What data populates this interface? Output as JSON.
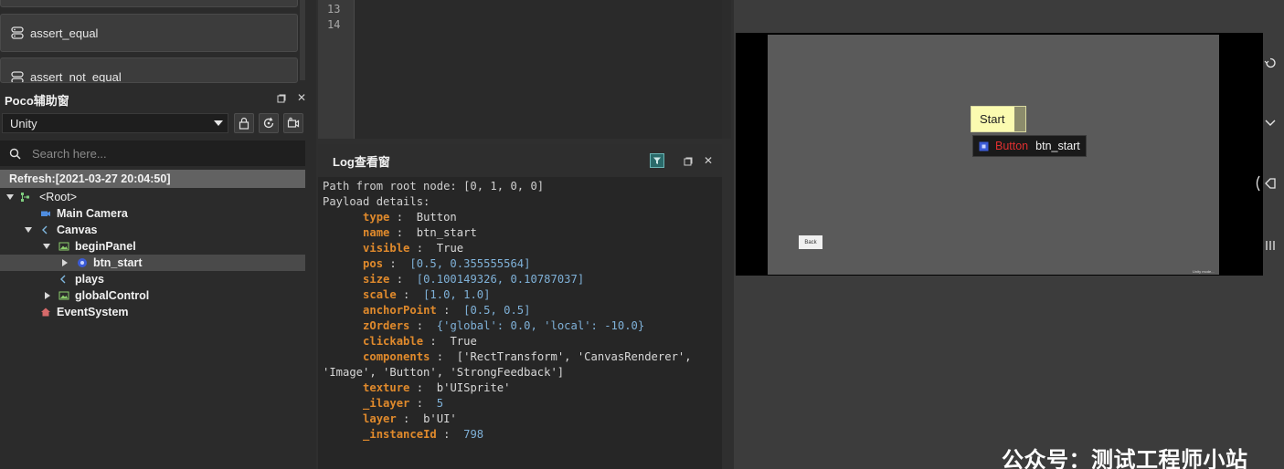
{
  "assert_panel": {
    "items": [
      {
        "label": ""
      },
      {
        "label": "assert_equal"
      },
      {
        "label": "assert_not_equal"
      }
    ]
  },
  "poco_panel": {
    "title": "Poco辅助窗",
    "engine": "Unity",
    "search_placeholder": "Search here...",
    "refresh": "Refresh:[2021-03-27 20:04:50]"
  },
  "tree": {
    "root": "<Root>",
    "main_camera": "Main Camera",
    "canvas": "Canvas",
    "begin_panel": "beginPanel",
    "btn_start": "btn_start",
    "plays": "plays",
    "global_control": "globalControl",
    "event_system": "EventSystem"
  },
  "editor": {
    "line_13": "13",
    "line_14": "14"
  },
  "log_panel": {
    "title": "Log查看窗",
    "path_line": "Path from root node: [0, 1, 0, 0]",
    "payload_title": "Payload details:",
    "fields": {
      "type": {
        "key": "type",
        "value": "Button"
      },
      "name": {
        "key": "name",
        "value": "btn_start"
      },
      "visible": {
        "key": "visible",
        "value": "True"
      },
      "pos": {
        "key": "pos",
        "value": "[0.5, 0.355555564]"
      },
      "size": {
        "key": "size",
        "value": "[0.100149326, 0.10787037]"
      },
      "scale": {
        "key": "scale",
        "value": "[1.0, 1.0]"
      },
      "anchorPoint": {
        "key": "anchorPoint",
        "value": "[0.5, 0.5]"
      },
      "zOrders": {
        "key": "zOrders",
        "value": "{'global': 0.0, 'local': -10.0}"
      },
      "clickable": {
        "key": "clickable",
        "value": "True"
      },
      "components": {
        "key": "components",
        "value": "['RectTransform', 'CanvasRenderer',",
        "value_cont": "'Image', 'Button', 'StrongFeedback']"
      },
      "texture": {
        "key": "texture",
        "value": "b'UISprite'"
      },
      "ilayer": {
        "key": "_ilayer",
        "value": "5"
      },
      "layer": {
        "key": "layer",
        "value": "b'UI'"
      },
      "instanceId": {
        "key": "_instanceId",
        "value": "798"
      }
    }
  },
  "game_view": {
    "start_label": "Start",
    "tooltip_type": "Button",
    "tooltip_name": "btn_start",
    "back_label": "Back",
    "tiny_label": "Unity mode..."
  },
  "watermark": "公众号：测试工程师小站",
  "colors": {
    "key_orange": "#e08a2c",
    "number_blue": "#7fb1d8",
    "tooltip_red": "#e03030",
    "start_yellow": "#fbfbb0"
  }
}
